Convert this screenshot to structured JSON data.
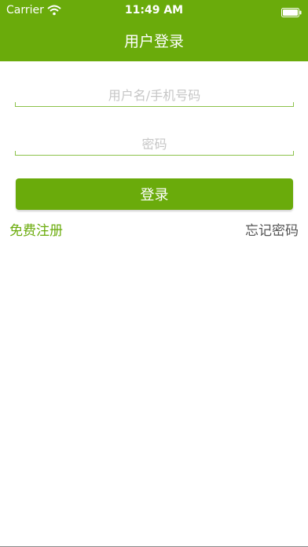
{
  "status_bar": {
    "carrier": "Carrier",
    "time": "11:49 AM",
    "wifi_icon": "wifi-icon",
    "battery_icon": "battery-icon"
  },
  "header": {
    "title": "用户登录",
    "background_color": "#6aab0b"
  },
  "form": {
    "username_placeholder": "用户名/手机号码",
    "username_value": "",
    "password_placeholder": "密码",
    "password_value": "",
    "login_label": "登录"
  },
  "links": {
    "register_label": "免费注册",
    "forgot_label": "忘记密码"
  },
  "colors": {
    "accent": "#6aab0b",
    "underline": "#8cc24a",
    "placeholder": "#c6c6c6",
    "secondary_text": "#555555"
  }
}
